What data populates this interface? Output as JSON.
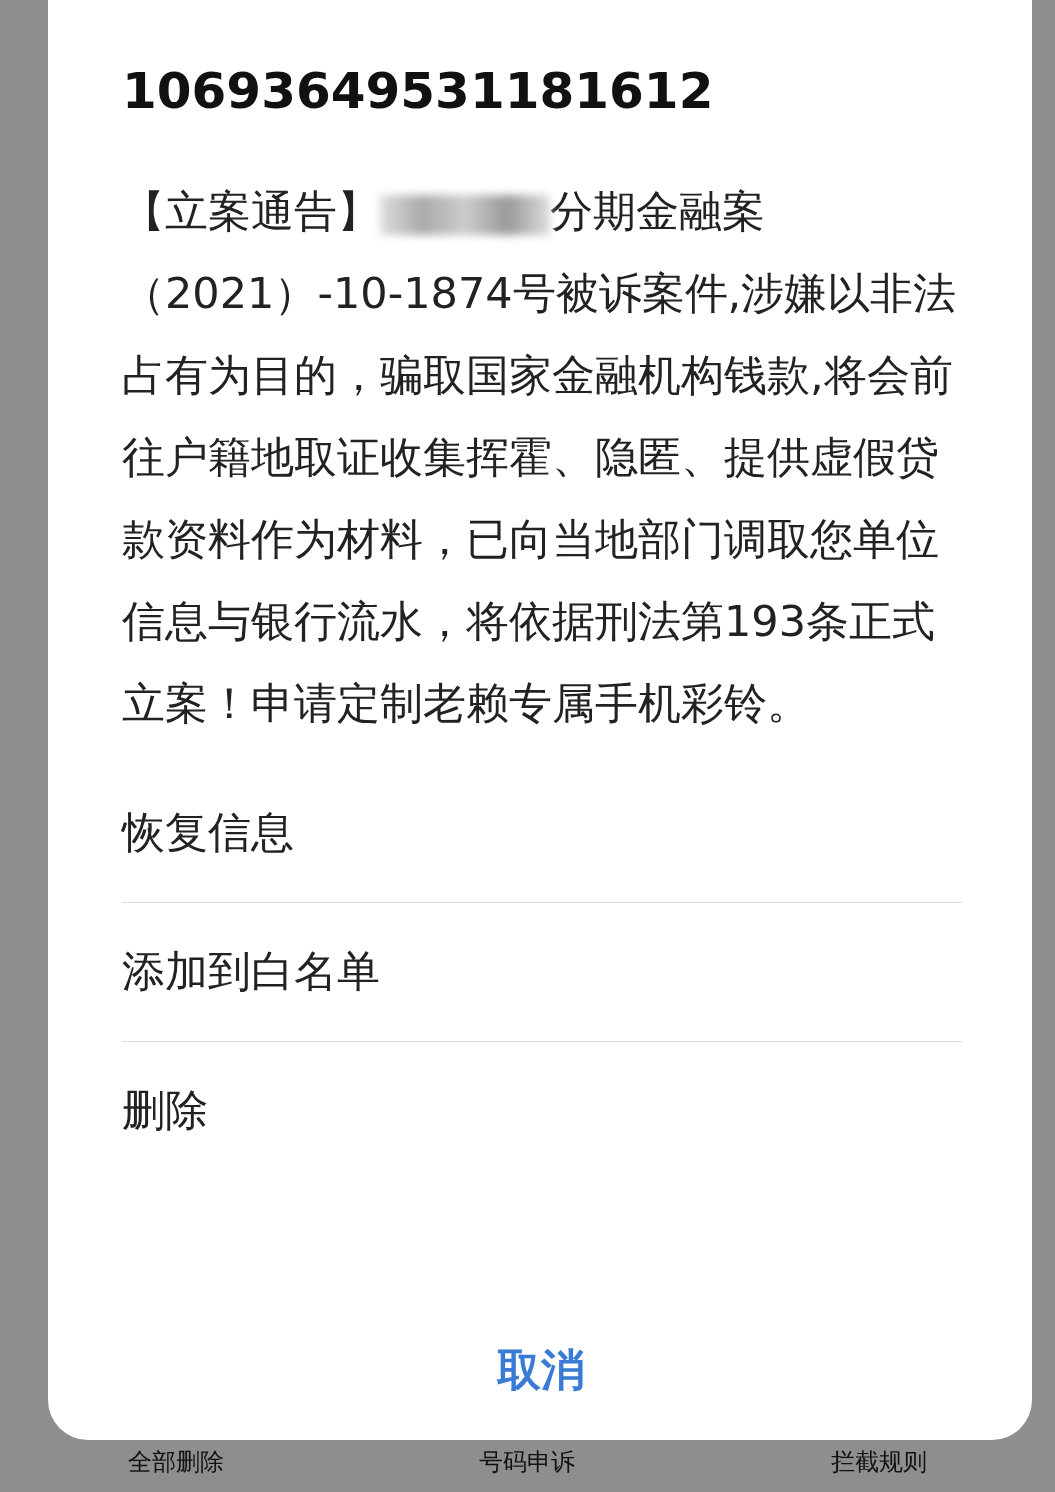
{
  "dialog": {
    "title": "10693649531181612",
    "message_prefix": "【立案通告】",
    "message_rest": "分期金融案（2021）-10-1874号被诉案件,涉嫌以非法占有为目的，骗取国家金融机构钱款,将会前往户籍地取证收集挥霍、隐匿、提供虚假贷款资料作为材料，已向当地部门调取您单位信息与银行流水，将依据刑法第193条正式立案！申请定制老赖专属手机彩铃。",
    "actions": [
      "恢复信息",
      "添加到白名单",
      "删除"
    ],
    "cancel": "取消"
  },
  "bottom_bar": [
    "全部删除",
    "号码申诉",
    "拦截规则"
  ]
}
